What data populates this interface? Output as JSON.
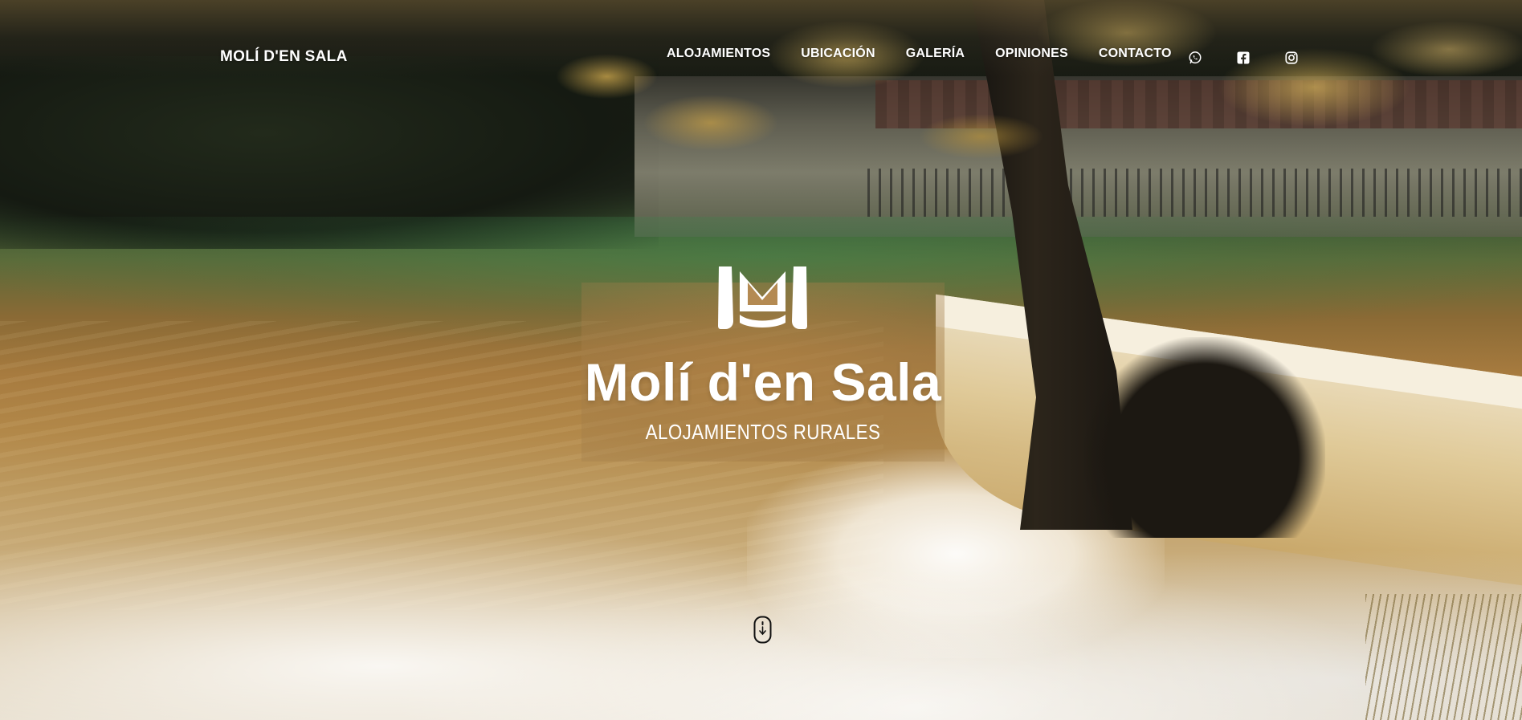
{
  "nav": {
    "brand": "MOLÍ D'EN SALA",
    "items": [
      {
        "label": "ALOJAMIENTOS"
      },
      {
        "label": "UBICACIÓN"
      },
      {
        "label": "GALERÍA"
      },
      {
        "label": "OPINIONES"
      },
      {
        "label": "CONTACTO"
      }
    ],
    "socials": [
      {
        "icon": "whatsapp-icon"
      },
      {
        "icon": "facebook-icon"
      },
      {
        "icon": "instagram-icon"
      }
    ]
  },
  "hero": {
    "logo_icon": "m-monogram-logo",
    "title": "Molí d'en Sala",
    "subtitle": "ALOJAMIENTOS RURALES",
    "scroll_icon": "scroll-mouse-icon"
  },
  "colors": {
    "text": "#ffffff",
    "logo_box": "#b08048"
  }
}
